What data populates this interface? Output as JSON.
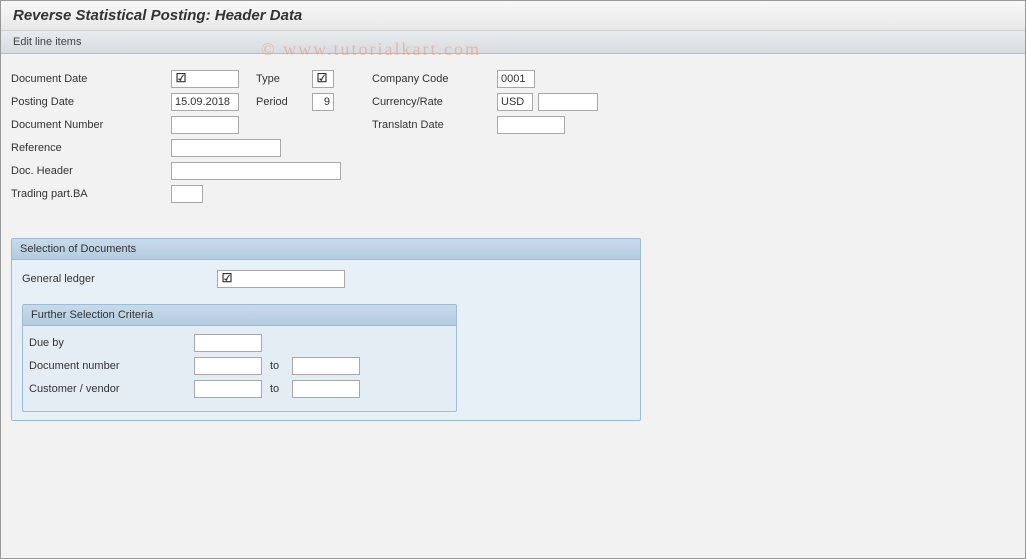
{
  "title": "Reverse Statistical Posting: Header Data",
  "toolbar": {
    "edit_line_items": "Edit line items"
  },
  "watermark": "© www.tutorialkart.com",
  "header": {
    "document_date": {
      "label": "Document Date",
      "value": ""
    },
    "type": {
      "label": "Type",
      "value": ""
    },
    "company_code": {
      "label": "Company Code",
      "value": "0001"
    },
    "posting_date": {
      "label": "Posting Date",
      "value": "15.09.2018"
    },
    "period": {
      "label": "Period",
      "value": "9"
    },
    "currency_rate": {
      "label": "Currency/Rate",
      "value1": "USD",
      "value2": ""
    },
    "document_number": {
      "label": "Document Number",
      "value": ""
    },
    "translatn_date": {
      "label": "Translatn Date",
      "value": ""
    },
    "reference": {
      "label": "Reference",
      "value": ""
    },
    "doc_header": {
      "label": "Doc. Header",
      "value": ""
    },
    "trading_part_ba": {
      "label": "Trading part.BA",
      "value": ""
    }
  },
  "selection": {
    "title": "Selection of Documents",
    "general_ledger": {
      "label": "General ledger",
      "value": ""
    },
    "further": {
      "title": "Further Selection Criteria",
      "due_by": {
        "label": "Due by",
        "value": ""
      },
      "doc_number": {
        "label": "Document number",
        "from": "",
        "to_label": "to",
        "to": ""
      },
      "cust_vendor": {
        "label": "Customer / vendor",
        "from": "",
        "to_label": "to",
        "to": ""
      }
    }
  }
}
